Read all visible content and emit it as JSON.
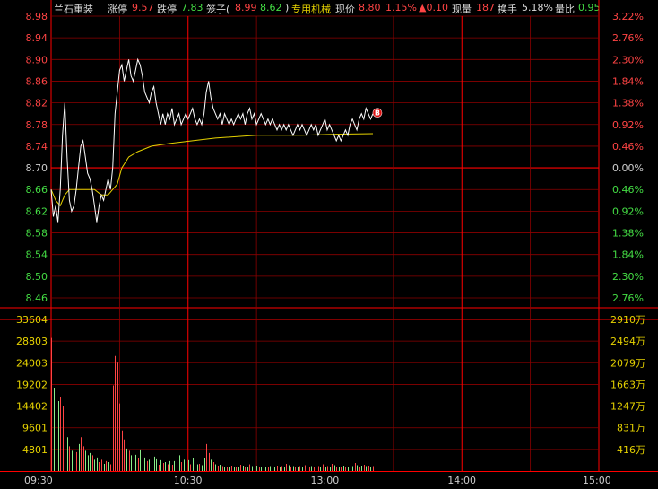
{
  "header": {
    "name": "兰石重装",
    "limit_up_label": "涨停",
    "limit_up_value": "9.57",
    "limit_down_label": "跌停",
    "limit_down_value": "7.83",
    "cage_label": "笼子(",
    "cage_high": "8.99",
    "cage_low": "8.62",
    "cage_close": ")",
    "sector": "专用机械",
    "price_label": "现价",
    "price_value": "8.80",
    "price_pct": "1.15%",
    "price_change": "▲0.10",
    "volume_label": "现量",
    "volume_value": "187",
    "turnover_label": "换手",
    "turnover_value": "5.18%",
    "volume_ratio_label": "量比",
    "volume_ratio_value": "0.95"
  },
  "colors": {
    "up": "#ff4444",
    "down": "#44dd44",
    "yellow": "#e6d200",
    "grid": "#8b0000",
    "axis": "#ff0000",
    "gray": "#cccccc"
  },
  "icons": {
    "marker": "b-marker-icon"
  },
  "chart_data": {
    "type": "line",
    "price_axis": {
      "left_labels": [
        "8.98",
        "8.94",
        "8.90",
        "8.86",
        "8.82",
        "8.78",
        "8.74",
        "8.70",
        "8.66",
        "8.62",
        "8.58",
        "8.54",
        "8.50",
        "8.46"
      ],
      "right_labels": [
        "3.22%",
        "2.76%",
        "2.30%",
        "1.84%",
        "1.38%",
        "0.92%",
        "0.46%",
        "0.00%",
        "0.46%",
        "0.92%",
        "1.38%",
        "1.84%",
        "2.30%",
        "2.76%"
      ],
      "ylim": [
        8.46,
        8.98
      ]
    },
    "volume_axis": {
      "left_labels": [
        "33604",
        "28803",
        "24003",
        "19202",
        "14402",
        "9601",
        "4801"
      ],
      "right_labels": [
        "2910万",
        "2494万",
        "2079万",
        "1663万",
        "1247万",
        "831万",
        "416万"
      ],
      "ylim": [
        0,
        33604
      ]
    },
    "time_labels": [
      "09:30",
      "10:30",
      "13:00",
      "14:00",
      "15:00"
    ],
    "total_minutes": 240,
    "price_series": [
      [
        0,
        8.66
      ],
      [
        1,
        8.61
      ],
      [
        2,
        8.63
      ],
      [
        3,
        8.6
      ],
      [
        4,
        8.66
      ],
      [
        5,
        8.76
      ],
      [
        6,
        8.82
      ],
      [
        7,
        8.72
      ],
      [
        8,
        8.64
      ],
      [
        9,
        8.62
      ],
      [
        10,
        8.63
      ],
      [
        11,
        8.66
      ],
      [
        12,
        8.7
      ],
      [
        13,
        8.74
      ],
      [
        14,
        8.75
      ],
      [
        15,
        8.72
      ],
      [
        16,
        8.69
      ],
      [
        17,
        8.68
      ],
      [
        18,
        8.66
      ],
      [
        19,
        8.63
      ],
      [
        20,
        8.6
      ],
      [
        21,
        8.63
      ],
      [
        22,
        8.65
      ],
      [
        23,
        8.64
      ],
      [
        24,
        8.66
      ],
      [
        25,
        8.68
      ],
      [
        26,
        8.66
      ],
      [
        27,
        8.7
      ],
      [
        28,
        8.8
      ],
      [
        29,
        8.84
      ],
      [
        30,
        8.88
      ],
      [
        31,
        8.89
      ],
      [
        32,
        8.86
      ],
      [
        33,
        8.88
      ],
      [
        34,
        8.9
      ],
      [
        35,
        8.87
      ],
      [
        36,
        8.86
      ],
      [
        37,
        8.88
      ],
      [
        38,
        8.9
      ],
      [
        39,
        8.89
      ],
      [
        40,
        8.87
      ],
      [
        41,
        8.84
      ],
      [
        42,
        8.83
      ],
      [
        43,
        8.82
      ],
      [
        44,
        8.84
      ],
      [
        45,
        8.85
      ],
      [
        46,
        8.82
      ],
      [
        47,
        8.8
      ],
      [
        48,
        8.78
      ],
      [
        49,
        8.8
      ],
      [
        50,
        8.78
      ],
      [
        51,
        8.8
      ],
      [
        52,
        8.79
      ],
      [
        53,
        8.81
      ],
      [
        54,
        8.78
      ],
      [
        55,
        8.79
      ],
      [
        56,
        8.8
      ],
      [
        57,
        8.78
      ],
      [
        58,
        8.79
      ],
      [
        59,
        8.8
      ],
      [
        60,
        8.79
      ],
      [
        61,
        8.8
      ],
      [
        62,
        8.81
      ],
      [
        63,
        8.79
      ],
      [
        64,
        8.78
      ],
      [
        65,
        8.79
      ],
      [
        66,
        8.78
      ],
      [
        67,
        8.8
      ],
      [
        68,
        8.84
      ],
      [
        69,
        8.86
      ],
      [
        70,
        8.83
      ],
      [
        71,
        8.81
      ],
      [
        72,
        8.8
      ],
      [
        73,
        8.79
      ],
      [
        74,
        8.8
      ],
      [
        75,
        8.78
      ],
      [
        76,
        8.8
      ],
      [
        77,
        8.79
      ],
      [
        78,
        8.78
      ],
      [
        79,
        8.79
      ],
      [
        80,
        8.78
      ],
      [
        81,
        8.79
      ],
      [
        82,
        8.8
      ],
      [
        83,
        8.79
      ],
      [
        84,
        8.8
      ],
      [
        85,
        8.78
      ],
      [
        86,
        8.8
      ],
      [
        87,
        8.81
      ],
      [
        88,
        8.79
      ],
      [
        89,
        8.8
      ],
      [
        90,
        8.78
      ],
      [
        91,
        8.79
      ],
      [
        92,
        8.8
      ],
      [
        93,
        8.79
      ],
      [
        94,
        8.78
      ],
      [
        95,
        8.79
      ],
      [
        96,
        8.78
      ],
      [
        97,
        8.79
      ],
      [
        98,
        8.78
      ],
      [
        99,
        8.77
      ],
      [
        100,
        8.78
      ],
      [
        101,
        8.77
      ],
      [
        102,
        8.78
      ],
      [
        103,
        8.77
      ],
      [
        104,
        8.78
      ],
      [
        105,
        8.77
      ],
      [
        106,
        8.76
      ],
      [
        107,
        8.77
      ],
      [
        108,
        8.78
      ],
      [
        109,
        8.77
      ],
      [
        110,
        8.78
      ],
      [
        111,
        8.77
      ],
      [
        112,
        8.76
      ],
      [
        113,
        8.77
      ],
      [
        114,
        8.78
      ],
      [
        115,
        8.77
      ],
      [
        116,
        8.78
      ],
      [
        117,
        8.76
      ],
      [
        118,
        8.77
      ],
      [
        119,
        8.78
      ],
      [
        120,
        8.79
      ],
      [
        121,
        8.77
      ],
      [
        122,
        8.78
      ],
      [
        123,
        8.77
      ],
      [
        124,
        8.76
      ],
      [
        125,
        8.75
      ],
      [
        126,
        8.76
      ],
      [
        127,
        8.75
      ],
      [
        128,
        8.76
      ],
      [
        129,
        8.77
      ],
      [
        130,
        8.76
      ],
      [
        131,
        8.78
      ],
      [
        132,
        8.79
      ],
      [
        133,
        8.78
      ],
      [
        134,
        8.77
      ],
      [
        135,
        8.79
      ],
      [
        136,
        8.8
      ],
      [
        137,
        8.79
      ],
      [
        138,
        8.81
      ],
      [
        139,
        8.8
      ],
      [
        140,
        8.79
      ],
      [
        141,
        8.8
      ]
    ],
    "avg_series": [
      [
        0,
        8.66
      ],
      [
        2,
        8.64
      ],
      [
        4,
        8.63
      ],
      [
        6,
        8.65
      ],
      [
        8,
        8.66
      ],
      [
        10,
        8.66
      ],
      [
        13,
        8.66
      ],
      [
        16,
        8.66
      ],
      [
        19,
        8.66
      ],
      [
        22,
        8.65
      ],
      [
        25,
        8.65
      ],
      [
        27,
        8.66
      ],
      [
        29,
        8.67
      ],
      [
        31,
        8.7
      ],
      [
        34,
        8.72
      ],
      [
        38,
        8.73
      ],
      [
        44,
        8.74
      ],
      [
        52,
        8.745
      ],
      [
        62,
        8.75
      ],
      [
        72,
        8.755
      ],
      [
        90,
        8.76
      ],
      [
        110,
        8.76
      ],
      [
        125,
        8.762
      ],
      [
        141,
        8.763
      ]
    ],
    "volume_series": [
      [
        0,
        29500,
        "up"
      ],
      [
        1,
        18500,
        "down"
      ],
      [
        2,
        17500,
        "up"
      ],
      [
        3,
        15500,
        "down"
      ],
      [
        4,
        16500,
        "up"
      ],
      [
        5,
        14500,
        "up"
      ],
      [
        6,
        11500,
        "up"
      ],
      [
        7,
        7500,
        "down"
      ],
      [
        8,
        5500,
        "up"
      ],
      [
        9,
        4500,
        "down"
      ],
      [
        10,
        5000,
        "down"
      ],
      [
        11,
        4200,
        "up"
      ],
      [
        12,
        6000,
        "down"
      ],
      [
        13,
        7500,
        "up"
      ],
      [
        14,
        5500,
        "up"
      ],
      [
        15,
        4500,
        "down"
      ],
      [
        16,
        3500,
        "down"
      ],
      [
        17,
        4000,
        "down"
      ],
      [
        18,
        3500,
        "up"
      ],
      [
        19,
        2500,
        "down"
      ],
      [
        20,
        3000,
        "down"
      ],
      [
        21,
        2000,
        "up"
      ],
      [
        22,
        2500,
        "up"
      ],
      [
        23,
        1600,
        "down"
      ],
      [
        24,
        2200,
        "up"
      ],
      [
        25,
        2000,
        "down"
      ],
      [
        26,
        1500,
        "up"
      ],
      [
        27,
        19000,
        "up"
      ],
      [
        28,
        25500,
        "up"
      ],
      [
        29,
        24000,
        "up"
      ],
      [
        30,
        15000,
        "up"
      ],
      [
        31,
        9000,
        "up"
      ],
      [
        32,
        7000,
        "up"
      ],
      [
        33,
        5000,
        "down"
      ],
      [
        34,
        4500,
        "up"
      ],
      [
        35,
        3500,
        "down"
      ],
      [
        36,
        3000,
        "up"
      ],
      [
        37,
        3600,
        "down"
      ],
      [
        38,
        2800,
        "up"
      ],
      [
        39,
        4800,
        "down"
      ],
      [
        40,
        4200,
        "up"
      ],
      [
        41,
        3000,
        "down"
      ],
      [
        42,
        2200,
        "up"
      ],
      [
        43,
        2500,
        "down"
      ],
      [
        44,
        1800,
        "up"
      ],
      [
        45,
        3200,
        "down"
      ],
      [
        46,
        2600,
        "down"
      ],
      [
        47,
        1400,
        "up"
      ],
      [
        48,
        2400,
        "down"
      ],
      [
        49,
        1800,
        "up"
      ],
      [
        50,
        2000,
        "down"
      ],
      [
        51,
        1500,
        "up"
      ],
      [
        52,
        2200,
        "down"
      ],
      [
        53,
        1400,
        "up"
      ],
      [
        54,
        2200,
        "down"
      ],
      [
        55,
        5000,
        "up"
      ],
      [
        56,
        3500,
        "down"
      ],
      [
        57,
        2000,
        "up"
      ],
      [
        58,
        2500,
        "down"
      ],
      [
        59,
        1600,
        "up"
      ],
      [
        60,
        2400,
        "down"
      ],
      [
        61,
        1500,
        "up"
      ],
      [
        62,
        2800,
        "down"
      ],
      [
        63,
        2100,
        "up"
      ],
      [
        64,
        1500,
        "down"
      ],
      [
        65,
        1600,
        "up"
      ],
      [
        66,
        1300,
        "down"
      ],
      [
        67,
        2800,
        "down"
      ],
      [
        68,
        6000,
        "up"
      ],
      [
        69,
        4000,
        "up"
      ],
      [
        70,
        2500,
        "down"
      ],
      [
        71,
        2000,
        "up"
      ],
      [
        72,
        1500,
        "down"
      ],
      [
        73,
        1200,
        "up"
      ],
      [
        74,
        1400,
        "down"
      ],
      [
        75,
        1100,
        "up"
      ],
      [
        76,
        900,
        "down"
      ],
      [
        77,
        1000,
        "up"
      ],
      [
        78,
        800,
        "down"
      ],
      [
        79,
        1200,
        "up"
      ],
      [
        80,
        900,
        "down"
      ],
      [
        81,
        1000,
        "up"
      ],
      [
        82,
        800,
        "down"
      ],
      [
        83,
        1400,
        "up"
      ],
      [
        84,
        1200,
        "down"
      ],
      [
        85,
        1000,
        "up"
      ],
      [
        86,
        900,
        "down"
      ],
      [
        87,
        1500,
        "up"
      ],
      [
        88,
        1100,
        "down"
      ],
      [
        89,
        900,
        "up"
      ],
      [
        90,
        1200,
        "down"
      ],
      [
        91,
        1000,
        "up"
      ],
      [
        92,
        800,
        "down"
      ],
      [
        93,
        1600,
        "up"
      ],
      [
        94,
        1000,
        "down"
      ],
      [
        95,
        900,
        "up"
      ],
      [
        96,
        1100,
        "down"
      ],
      [
        97,
        1400,
        "up"
      ],
      [
        98,
        800,
        "down"
      ],
      [
        99,
        1200,
        "up"
      ],
      [
        100,
        900,
        "down"
      ],
      [
        101,
        1100,
        "up"
      ],
      [
        102,
        800,
        "down"
      ],
      [
        103,
        1600,
        "up"
      ],
      [
        104,
        1300,
        "down"
      ],
      [
        105,
        900,
        "up"
      ],
      [
        106,
        1100,
        "down"
      ],
      [
        107,
        800,
        "up"
      ],
      [
        108,
        1000,
        "down"
      ],
      [
        109,
        1100,
        "up"
      ],
      [
        110,
        900,
        "down"
      ],
      [
        111,
        1300,
        "up"
      ],
      [
        112,
        1000,
        "down"
      ],
      [
        113,
        800,
        "up"
      ],
      [
        114,
        1100,
        "down"
      ],
      [
        115,
        900,
        "up"
      ],
      [
        116,
        1000,
        "down"
      ],
      [
        117,
        1100,
        "up"
      ],
      [
        118,
        800,
        "down"
      ],
      [
        119,
        1500,
        "up"
      ],
      [
        120,
        900,
        "down"
      ],
      [
        121,
        1100,
        "up"
      ],
      [
        122,
        800,
        "down"
      ],
      [
        123,
        1600,
        "up"
      ],
      [
        124,
        1300,
        "down"
      ],
      [
        125,
        900,
        "up"
      ],
      [
        126,
        1000,
        "down"
      ],
      [
        127,
        900,
        "up"
      ],
      [
        128,
        1200,
        "down"
      ],
      [
        129,
        900,
        "up"
      ],
      [
        130,
        1000,
        "down"
      ],
      [
        131,
        1600,
        "up"
      ],
      [
        132,
        1100,
        "down"
      ],
      [
        133,
        1800,
        "up"
      ],
      [
        134,
        1300,
        "down"
      ],
      [
        135,
        1000,
        "up"
      ],
      [
        136,
        1200,
        "down"
      ],
      [
        137,
        1400,
        "up"
      ],
      [
        138,
        1100,
        "down"
      ],
      [
        139,
        1200,
        "up"
      ],
      [
        140,
        900,
        "down"
      ],
      [
        141,
        1100,
        "up"
      ]
    ]
  }
}
